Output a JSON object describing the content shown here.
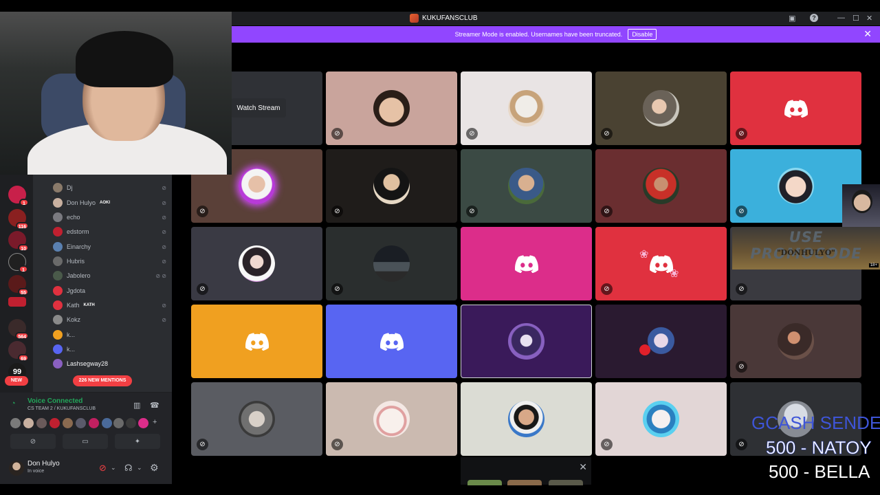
{
  "window": {
    "app_title": "KUKUFANSCLUB"
  },
  "banner": {
    "message": "Streamer Mode is enabled. Usernames have been truncated.",
    "disable_label": "Disable"
  },
  "stage": {
    "watch_stream_label": "Watch Stream"
  },
  "server_badges": [
    "1",
    "116",
    "10",
    "1",
    "55",
    "564",
    "69"
  ],
  "new_label": "NEW",
  "members": [
    {
      "name": "Dj",
      "tag": ""
    },
    {
      "name": "Don Hulyo",
      "tag": "AOKI"
    },
    {
      "name": "echo",
      "tag": ""
    },
    {
      "name": "edstorm",
      "tag": ""
    },
    {
      "name": "Einarchy",
      "tag": ""
    },
    {
      "name": "Hubris",
      "tag": ""
    },
    {
      "name": "Jabolero",
      "tag": ""
    },
    {
      "name": "Jgdota",
      "tag": ""
    },
    {
      "name": "Kath",
      "tag": "KATH"
    },
    {
      "name": "Kokz",
      "tag": ""
    },
    {
      "name": "k...",
      "tag": ""
    },
    {
      "name": "k...",
      "tag": ""
    },
    {
      "name": "Lashsegway28",
      "tag": ""
    }
  ],
  "mentions_label": "226 NEW MENTIONS",
  "voice": {
    "title": "Voice Connected",
    "channel": "CS TEAM 2 / KUKUFANSCLUB"
  },
  "user": {
    "name": "Don Hulyo",
    "status": "In voice"
  },
  "overlay": {
    "promo_line1": "USE PROMOCODE",
    "promo_line2": "\"DONHULYO\"",
    "promo_age": "18+",
    "gcash_title": "GCASH SENDER",
    "gcash_entries": [
      "500 - NATOY",
      "500  - BELLA"
    ]
  },
  "colors": {
    "discord_purple": "#9146ff",
    "discord_red": "#e0313f",
    "discord_pink": "#dc2d8a",
    "discord_orange": "#f0a020",
    "discord_blurple": "#5865f2",
    "voice_green": "#23a55a"
  }
}
